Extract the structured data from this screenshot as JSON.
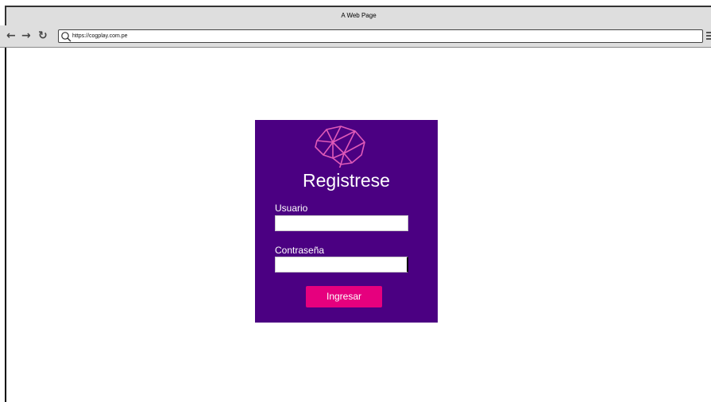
{
  "window": {
    "title": "A Web Page"
  },
  "toolbar": {
    "back_icon": "back-arrow-icon",
    "forward_icon": "forward-arrow-icon",
    "reload_icon": "reload-icon",
    "url": "https://cogplay.com.pe"
  },
  "login": {
    "logo_icon": "brain-logo-icon",
    "title": "Registrese",
    "username_label": "Usuario",
    "username_value": "",
    "password_label": "Contraseña",
    "password_value": "",
    "submit_label": "Ingresar"
  },
  "colors": {
    "card_background": "#4b0082",
    "button_background": "#e6007e",
    "logo_color": "#e05ab8",
    "chrome": "#dedede"
  }
}
